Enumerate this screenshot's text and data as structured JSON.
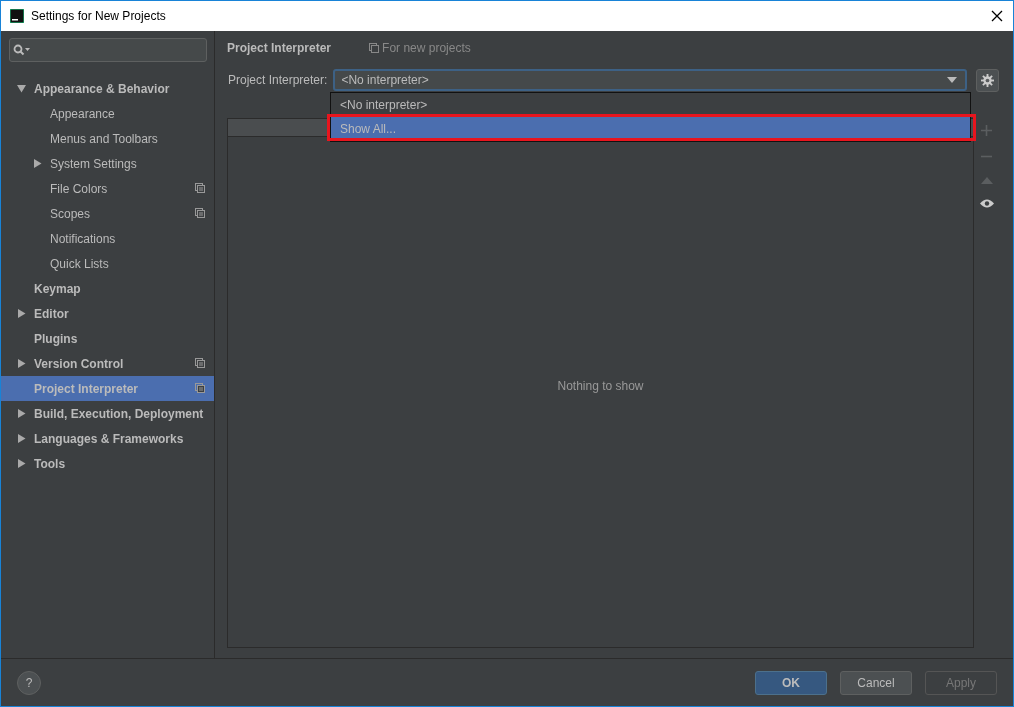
{
  "window": {
    "title": "Settings for New Projects"
  },
  "sidebar": {
    "items": [
      {
        "label": "Appearance & Behavior",
        "expanded": true,
        "selected": false,
        "per_project": false,
        "children": [
          {
            "label": "Appearance",
            "selected": false,
            "per_project": false
          },
          {
            "label": "Menus and Toolbars",
            "selected": false,
            "per_project": false
          },
          {
            "label": "System Settings",
            "expanded": false,
            "selected": false,
            "per_project": false
          },
          {
            "label": "File Colors",
            "selected": false,
            "per_project": true
          },
          {
            "label": "Scopes",
            "selected": false,
            "per_project": true
          },
          {
            "label": "Notifications",
            "selected": false,
            "per_project": false
          },
          {
            "label": "Quick Lists",
            "selected": false,
            "per_project": false
          }
        ]
      },
      {
        "label": "Keymap",
        "selected": false,
        "per_project": false
      },
      {
        "label": "Editor",
        "expanded": false,
        "selected": false,
        "per_project": false
      },
      {
        "label": "Plugins",
        "selected": false,
        "per_project": false
      },
      {
        "label": "Version Control",
        "expanded": false,
        "selected": false,
        "per_project": true
      },
      {
        "label": "Project Interpreter",
        "selected": true,
        "per_project": true
      },
      {
        "label": "Build, Execution, Deployment",
        "expanded": false,
        "selected": false,
        "per_project": false
      },
      {
        "label": "Languages & Frameworks",
        "expanded": false,
        "selected": false,
        "per_project": false
      },
      {
        "label": "Tools",
        "expanded": false,
        "selected": false,
        "per_project": false
      }
    ]
  },
  "page": {
    "title": "Project Interpreter",
    "scope_note": "For new projects",
    "interpreter": {
      "label": "Project Interpreter:",
      "value": "<No interpreter>",
      "expanded": true,
      "options": [
        {
          "label": "<No interpreter>",
          "highlighted": false,
          "annotated": false
        },
        {
          "label": "Show All...",
          "highlighted": true,
          "annotated": true
        }
      ]
    },
    "table": {
      "empty_text": "Nothing to show"
    }
  },
  "help": {
    "label": "?"
  },
  "buttons": [
    {
      "label": "OK",
      "kind": "default",
      "disabled": false
    },
    {
      "label": "Cancel",
      "kind": "normal",
      "disabled": false
    },
    {
      "label": "Apply",
      "kind": "normal",
      "disabled": true
    }
  ]
}
